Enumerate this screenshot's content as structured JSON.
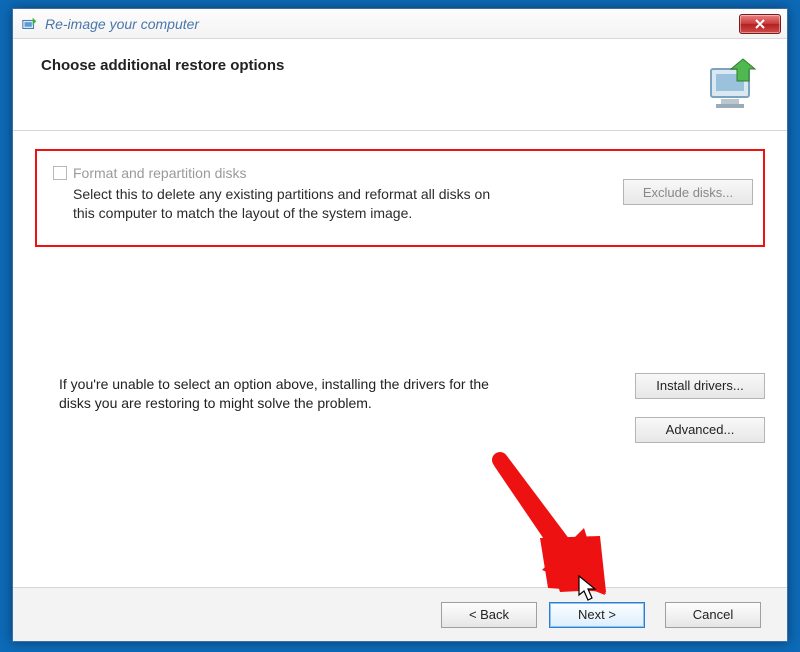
{
  "window": {
    "title": "Re-image your computer"
  },
  "header": {
    "title": "Choose additional restore options"
  },
  "format_section": {
    "checkbox_label": "Format and repartition disks",
    "description": "Select this to delete any existing partitions and reformat all disks on this computer to match the layout of the system image.",
    "exclude_btn": "Exclude disks..."
  },
  "help_section": {
    "text": "If you're unable to select an option above, installing the drivers for the disks you are restoring to might solve the problem.",
    "install_btn": "Install drivers...",
    "advanced_btn": "Advanced..."
  },
  "footer": {
    "back": "< Back",
    "next": "Next >",
    "cancel": "Cancel"
  }
}
